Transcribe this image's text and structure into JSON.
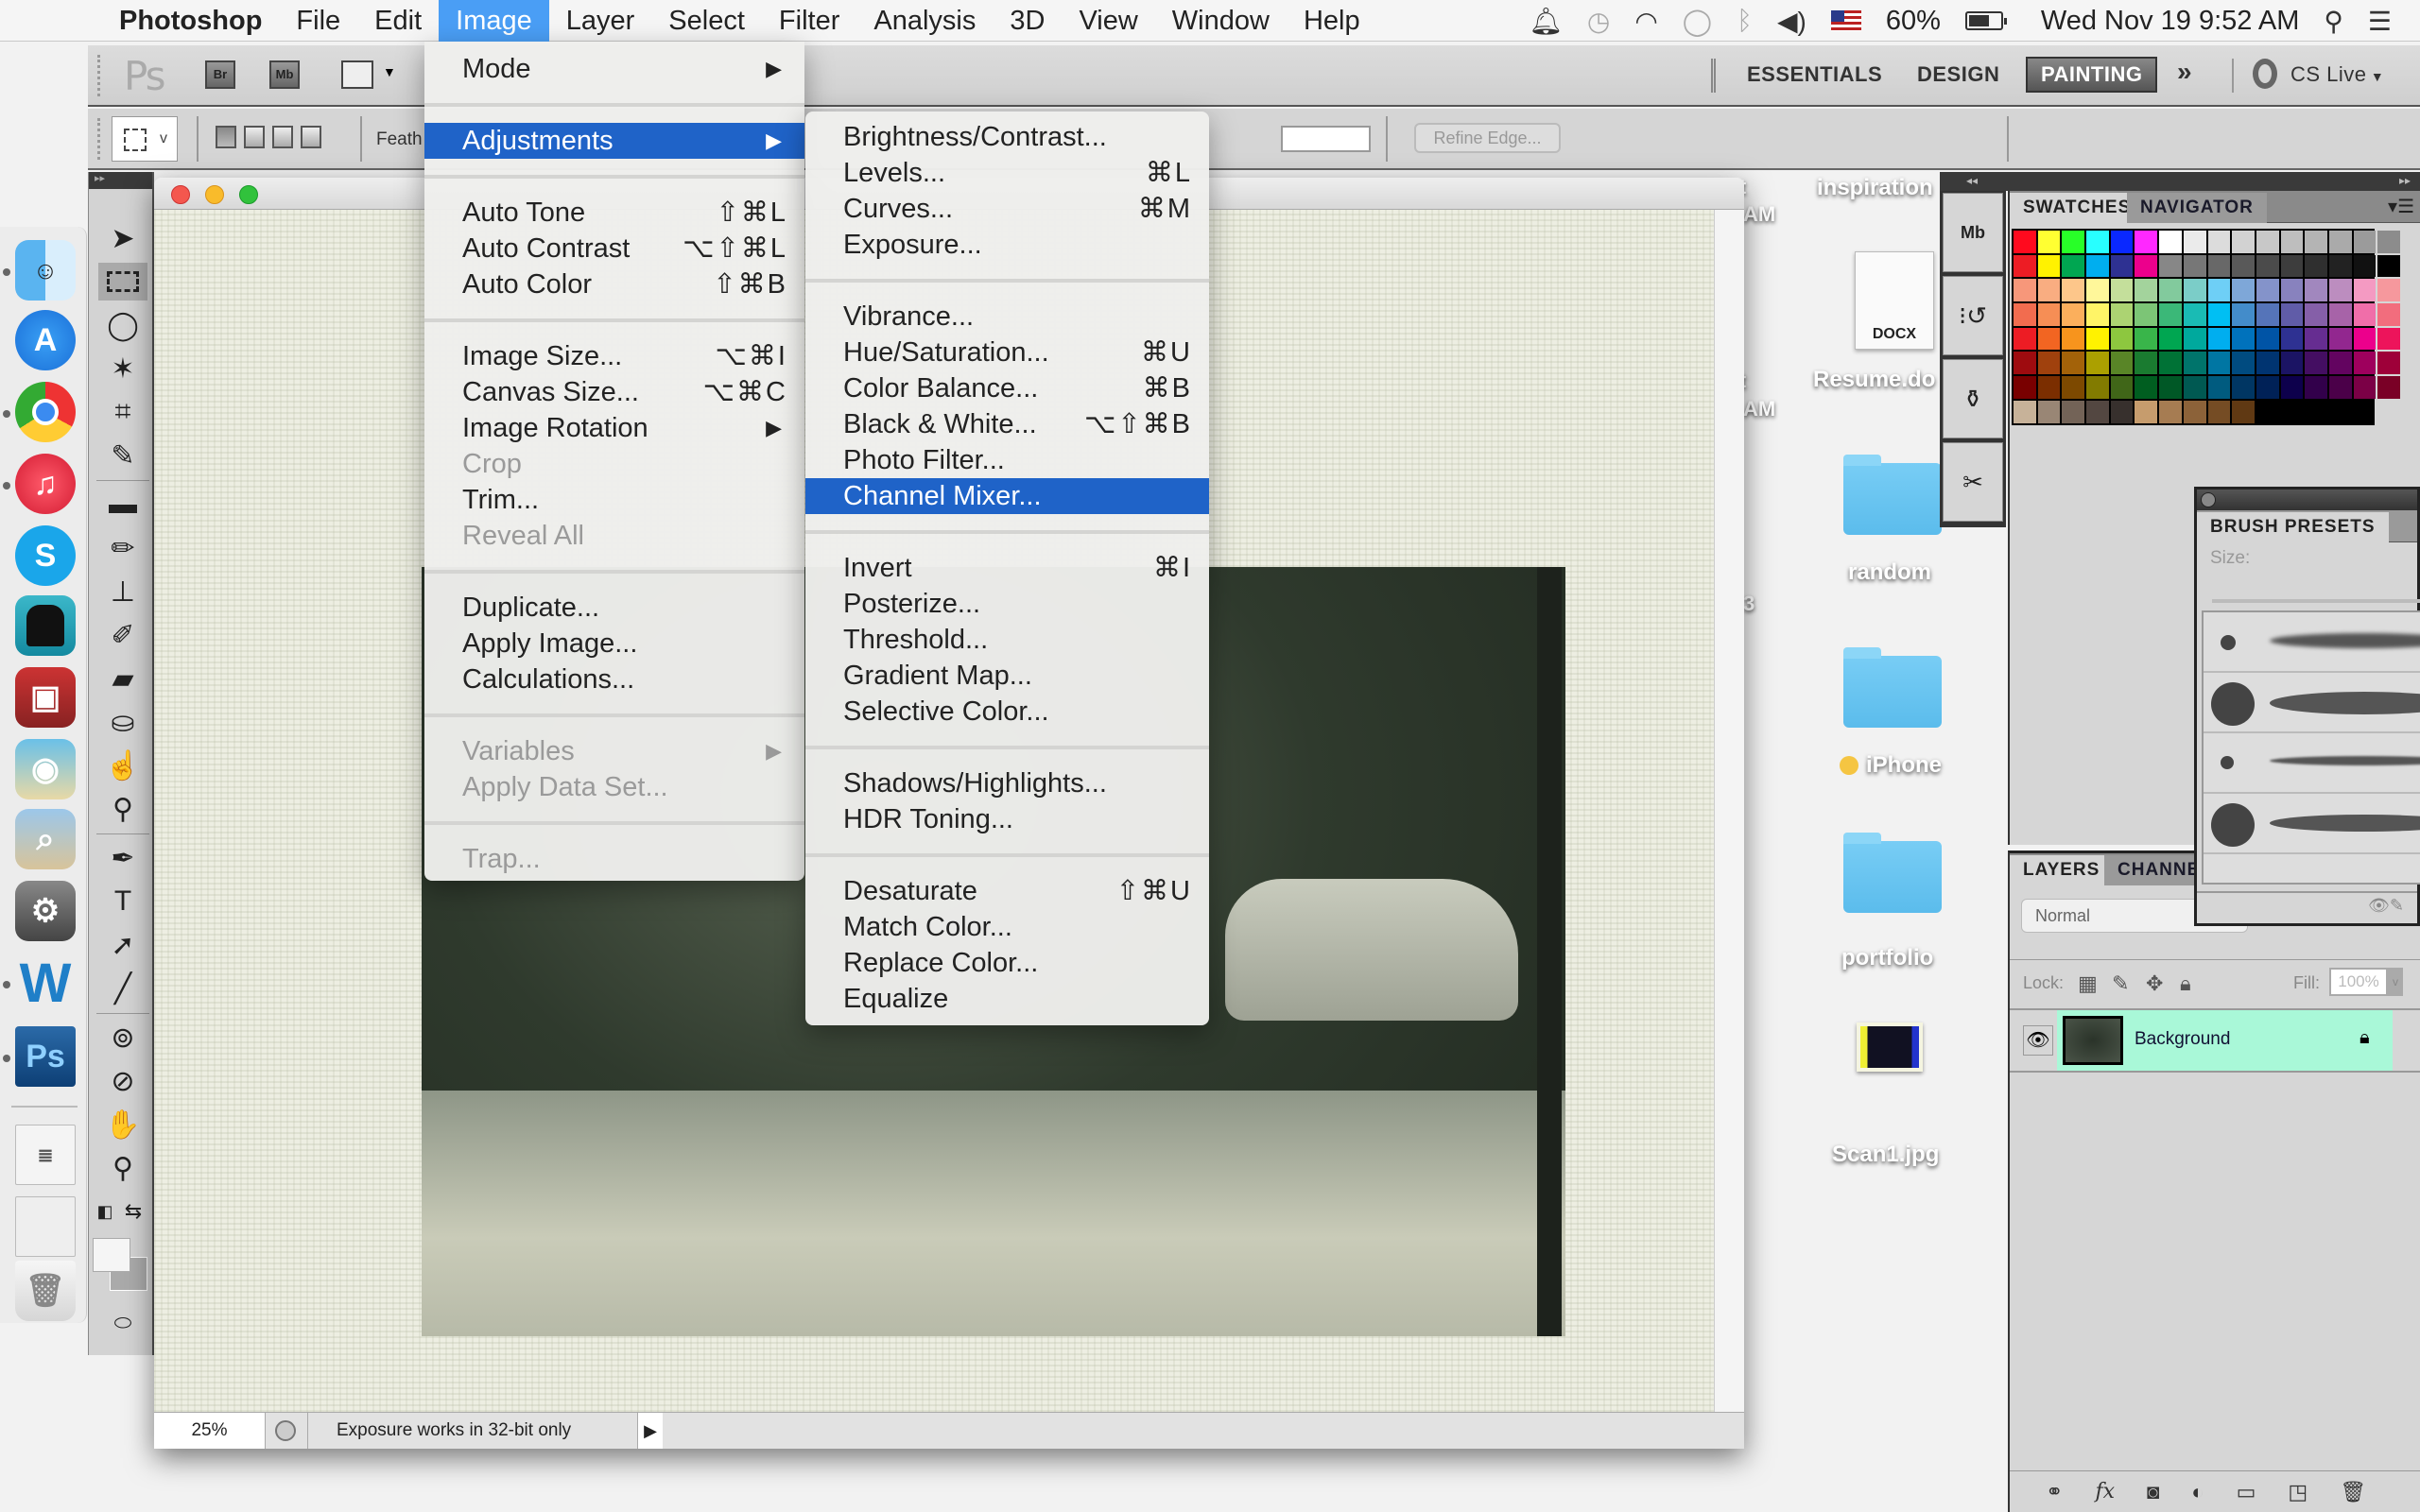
{
  "menubar": {
    "app_name": "Photoshop",
    "items": [
      "File",
      "Edit",
      "Image",
      "Layer",
      "Select",
      "Filter",
      "Analysis",
      "3D",
      "View",
      "Window",
      "Help"
    ],
    "active_item": "Image",
    "status": {
      "battery_percent": "60%",
      "datetime": "Wed Nov 19  9:52 AM",
      "icons": [
        "notification-bell-icon",
        "time-machine-icon",
        "wifi-icon",
        "messages-icon",
        "bluetooth-icon",
        "volume-icon",
        "us-flag-input-icon",
        "battery-icon",
        "spotlight-search-icon",
        "notification-center-icon"
      ]
    }
  },
  "appbar": {
    "logo": "Ps",
    "bridge_label": "Br",
    "minibridge_label": "Mb",
    "workspaces": [
      "ESSENTIALS",
      "DESIGN",
      "PAINTING"
    ],
    "active_workspace": "PAINTING",
    "more": "»",
    "cs_live": "CS Live"
  },
  "options_bar": {
    "feather_label": "Feath",
    "refine_edge": "Refine Edge..."
  },
  "image_menu": {
    "items": [
      {
        "label": "Mode",
        "submenu": true
      },
      {
        "sep": true
      },
      {
        "label": "Adjustments",
        "submenu": true,
        "highlighted": true
      },
      {
        "sep": true
      },
      {
        "label": "Auto Tone",
        "shortcut": "⇧⌘L"
      },
      {
        "label": "Auto Contrast",
        "shortcut": "⌥⇧⌘L"
      },
      {
        "label": "Auto Color",
        "shortcut": "⇧⌘B"
      },
      {
        "sep": true
      },
      {
        "label": "Image Size...",
        "shortcut": "⌥⌘I"
      },
      {
        "label": "Canvas Size...",
        "shortcut": "⌥⌘C"
      },
      {
        "label": "Image Rotation",
        "submenu": true
      },
      {
        "label": "Crop",
        "disabled": true
      },
      {
        "label": "Trim..."
      },
      {
        "label": "Reveal All",
        "disabled": true
      },
      {
        "sep": true
      },
      {
        "label": "Duplicate..."
      },
      {
        "label": "Apply Image..."
      },
      {
        "label": "Calculations..."
      },
      {
        "sep": true
      },
      {
        "label": "Variables",
        "submenu": true,
        "disabled": true
      },
      {
        "label": "Apply Data Set...",
        "disabled": true
      },
      {
        "sep": true
      },
      {
        "label": "Trap...",
        "disabled": true
      }
    ]
  },
  "adjustments_menu": {
    "items": [
      {
        "label": "Brightness/Contrast..."
      },
      {
        "label": "Levels...",
        "shortcut": "⌘L"
      },
      {
        "label": "Curves...",
        "shortcut": "⌘M"
      },
      {
        "label": "Exposure..."
      },
      {
        "sep": true
      },
      {
        "label": "Vibrance..."
      },
      {
        "label": "Hue/Saturation...",
        "shortcut": "⌘U"
      },
      {
        "label": "Color Balance...",
        "shortcut": "⌘B"
      },
      {
        "label": "Black & White...",
        "shortcut": "⌥⇧⌘B"
      },
      {
        "label": "Photo Filter..."
      },
      {
        "label": "Channel Mixer...",
        "highlighted": true
      },
      {
        "sep": true
      },
      {
        "label": "Invert",
        "shortcut": "⌘I"
      },
      {
        "label": "Posterize..."
      },
      {
        "label": "Threshold..."
      },
      {
        "label": "Gradient Map..."
      },
      {
        "label": "Selective Color..."
      },
      {
        "sep": true
      },
      {
        "label": "Shadows/Highlights..."
      },
      {
        "label": "HDR Toning..."
      },
      {
        "sep": true
      },
      {
        "label": "Desaturate",
        "shortcut": "⇧⌘U"
      },
      {
        "label": "Match Color..."
      },
      {
        "label": "Replace Color..."
      },
      {
        "label": "Equalize"
      }
    ]
  },
  "document": {
    "zoom": "25%",
    "status_text": "Exposure works in 32-bit only"
  },
  "desktop": {
    "items": [
      {
        "label": "inspiration",
        "type": "folder-label"
      },
      {
        "label": "Resume.do",
        "type": "docx",
        "badge": "DOCX"
      },
      {
        "label": "random",
        "type": "folder"
      },
      {
        "label": "iPhone",
        "type": "folder",
        "tag_color": "#f5c542"
      },
      {
        "label": "portfolio",
        "type": "folder"
      },
      {
        "label": "Scan1.jpg",
        "type": "image"
      }
    ],
    "clipped_fragments": [
      "t",
      "AM",
      "t",
      "AM",
      "3"
    ]
  },
  "dock": {
    "apps": [
      {
        "name": "finder",
        "running": true
      },
      {
        "name": "app-store",
        "running": false
      },
      {
        "name": "chrome",
        "running": true
      },
      {
        "name": "itunes",
        "running": true
      },
      {
        "name": "skype",
        "running": false
      },
      {
        "name": "spy-app",
        "running": false
      },
      {
        "name": "photo-booth",
        "running": false
      },
      {
        "name": "image-capture",
        "running": false
      },
      {
        "name": "preview",
        "running": false
      },
      {
        "name": "system-preferences",
        "running": false
      },
      {
        "name": "word",
        "running": true
      },
      {
        "name": "photoshop",
        "running": true,
        "label": "Ps"
      }
    ],
    "stacks": [
      "documents-stack",
      "downloads-stack",
      "trash"
    ]
  },
  "panels": {
    "swatches_tabs": [
      "SWATCHES",
      "NAVIGATOR"
    ],
    "active_swatch_tab": "SWATCHES",
    "swatches": [
      "#ff0a1e",
      "#ffff32",
      "#28ff28",
      "#28ffff",
      "#0a28ff",
      "#ff28ff",
      "#ffffff",
      "#ebebeb",
      "#dcdcdc",
      "#d2d2d2",
      "#c8c8c8",
      "#bebebe",
      "#b4b4b4",
      "#aaaaaa",
      "#9b9b9b",
      "#8c8c8c",
      "#ed1c24",
      "#fff200",
      "#00a651",
      "#00aeef",
      "#2e3192",
      "#ec008c",
      "#878787",
      "#777777",
      "#686868",
      "#595959",
      "#4b4b4b",
      "#3d3d3d",
      "#2f2f2f",
      "#222222",
      "#111111",
      "#000000",
      "#f7977a",
      "#f9ad81",
      "#fdc68a",
      "#fff79a",
      "#c4df9b",
      "#a3d39c",
      "#82ca9d",
      "#7bcdc8",
      "#6ecff6",
      "#7ea7d8",
      "#8493ca",
      "#8882be",
      "#a187be",
      "#bc8dbf",
      "#f49ac2",
      "#f6989d",
      "#f26c4f",
      "#f68e55",
      "#fbaf5c",
      "#fff467",
      "#acd372",
      "#7cc576",
      "#3bb878",
      "#1abbb4",
      "#00bff3",
      "#438cca",
      "#5574b9",
      "#605ca8",
      "#855fa8",
      "#a763a8",
      "#f06ea9",
      "#f26d7d",
      "#ed1c24",
      "#f26522",
      "#f7941d",
      "#fff200",
      "#8dc73f",
      "#39b54a",
      "#00a651",
      "#00a99d",
      "#00aeef",
      "#0072bc",
      "#0054a6",
      "#2e3192",
      "#662d91",
      "#92278f",
      "#ec008c",
      "#ed145b",
      "#9e0b0f",
      "#a0410d",
      "#a36209",
      "#aba000",
      "#598527",
      "#1a7b30",
      "#007236",
      "#00746b",
      "#0076a3",
      "#004b80",
      "#003471",
      "#1b1464",
      "#440e62",
      "#630460",
      "#9e005d",
      "#9e0039",
      "#790000",
      "#7b2e00",
      "#7d4900",
      "#827b00",
      "#406618",
      "#005e20",
      "#005826",
      "#005952",
      "#005b7f",
      "#003663",
      "#002157",
      "#0d004c",
      "#32004b",
      "#4b0049",
      "#7b0046",
      "#7a0026",
      "#c7b299",
      "#998675",
      "#736357",
      "#534741",
      "#37302d",
      "#c69c6d",
      "#a67c52",
      "#8c6239",
      "#754c24",
      "#603913"
    ],
    "brush_tab": "BRUSH PRESETS",
    "brush_size_label": "Size:",
    "layers_tabs": [
      "LAYERS",
      "CHANNEL"
    ],
    "active_layers_tab": "LAYERS",
    "blend_mode": "Normal",
    "lock_label": "Lock:",
    "fill_label": "Fill:",
    "fill_value": "100%",
    "layers": [
      {
        "name": "Background",
        "locked": true,
        "visible": true
      }
    ]
  }
}
